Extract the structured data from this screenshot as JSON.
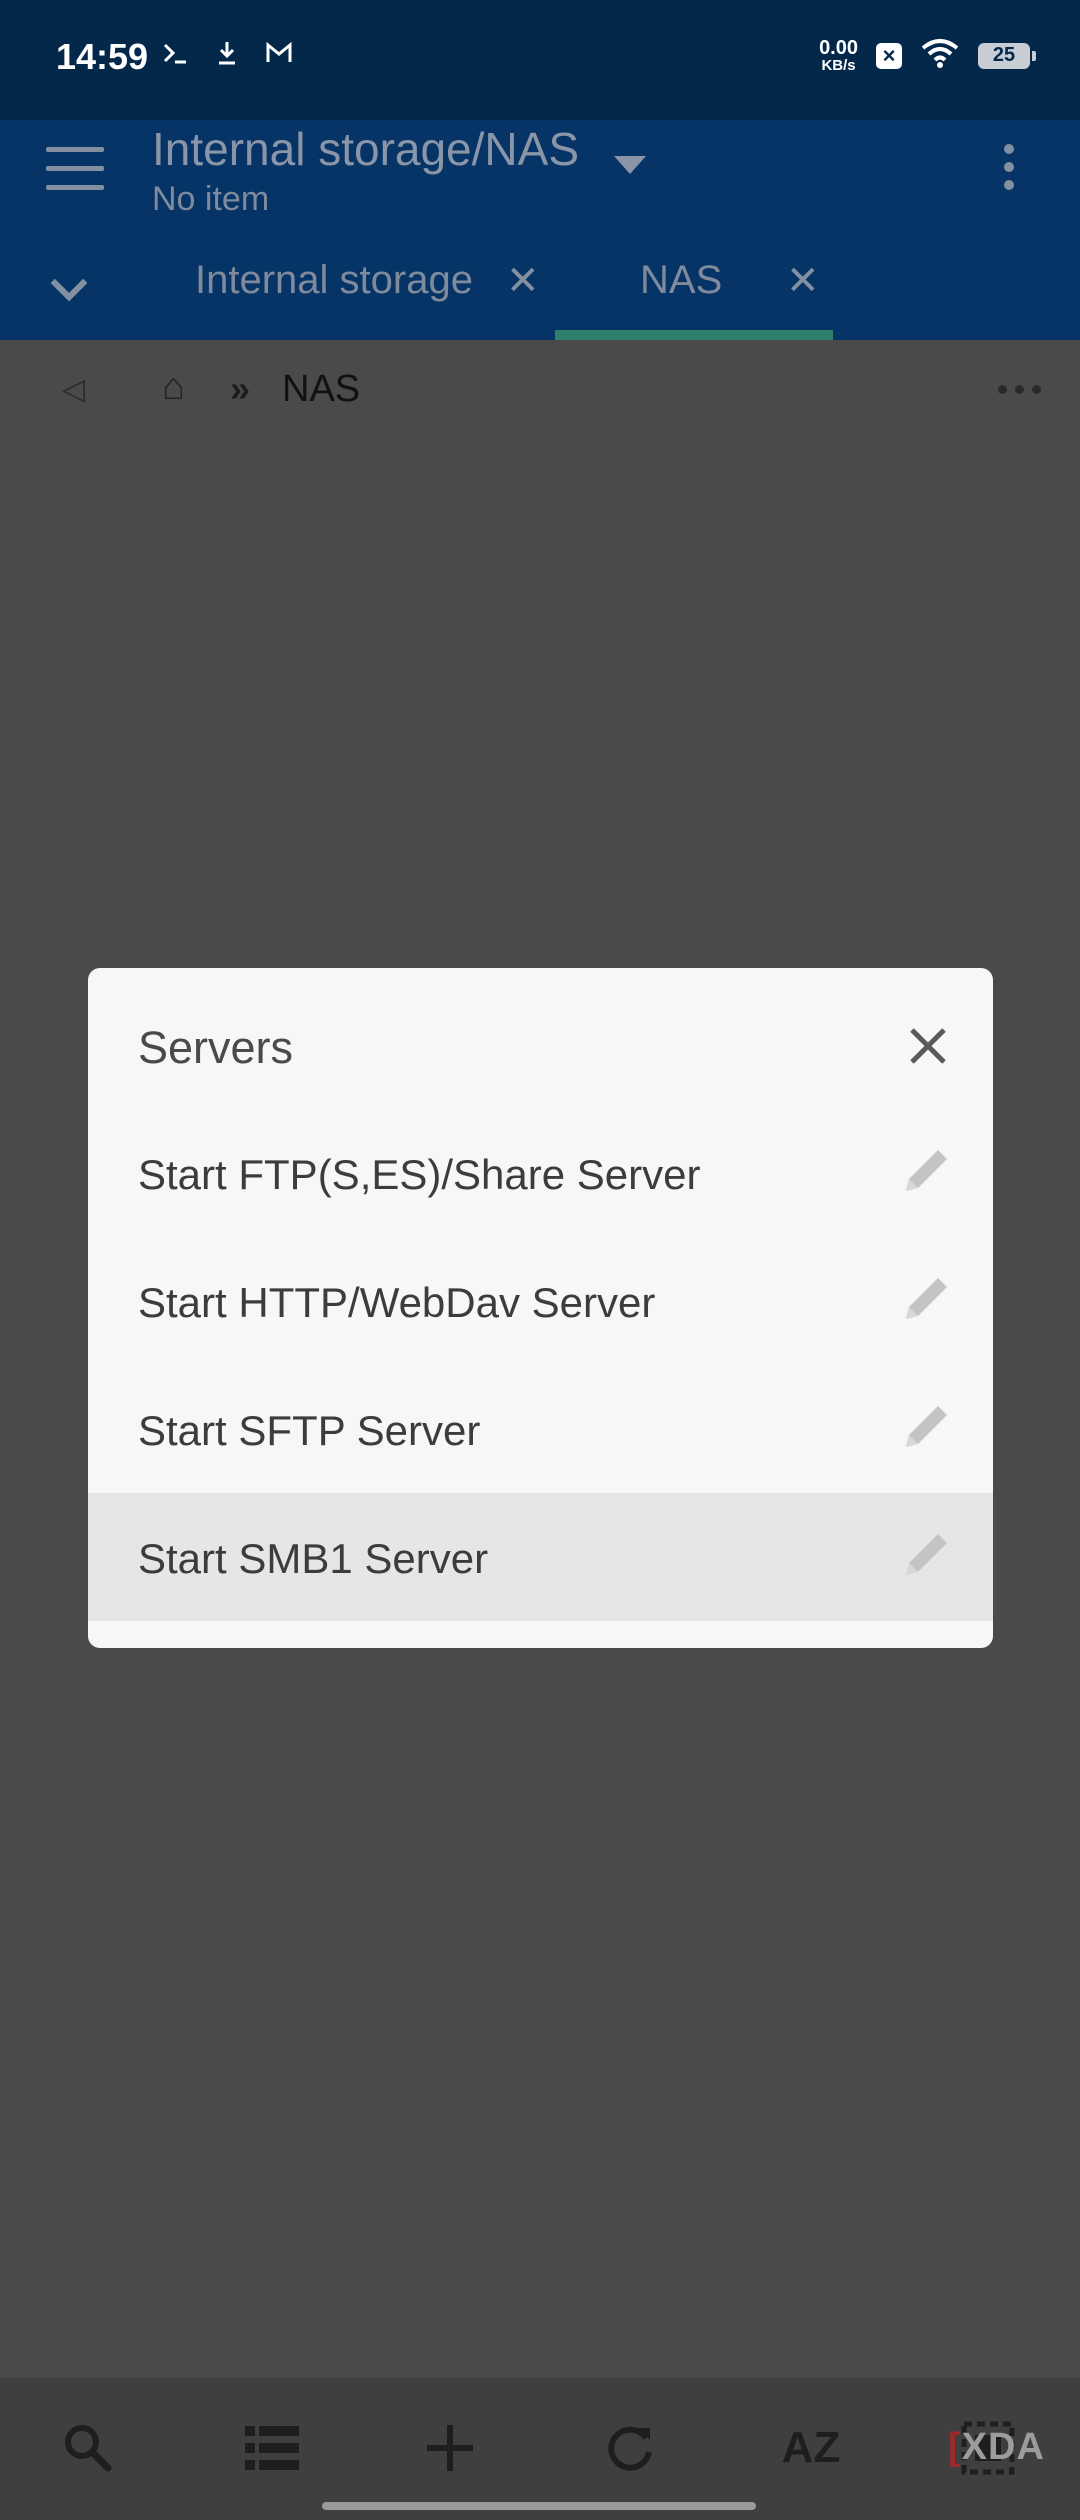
{
  "status_bar": {
    "time": "14:59",
    "left_icons": [
      "terminal-icon",
      "download-icon",
      "gmail-icon"
    ],
    "net_speed_value": "0.00",
    "net_speed_unit": "KB/s",
    "battery_level": "25"
  },
  "app_bar": {
    "title": "Internal storage/NAS",
    "subtitle": "No item"
  },
  "tabs": [
    {
      "label": "Internal storage",
      "active": false
    },
    {
      "label": "NAS",
      "active": true
    }
  ],
  "breadcrumb": {
    "separator": "»",
    "current": "NAS"
  },
  "dialog": {
    "title": "Servers",
    "items": [
      {
        "label": "Start FTP(S,ES)/Share Server",
        "selected": false
      },
      {
        "label": "Start HTTP/WebDav Server",
        "selected": false
      },
      {
        "label": "Start SFTP Server",
        "selected": false
      },
      {
        "label": "Start SMB1 Server",
        "selected": true
      }
    ]
  },
  "bottom_toolbar": {
    "sort_label": "AZ",
    "icons": [
      "search-icon",
      "list-view-icon",
      "add-icon",
      "refresh-icon",
      "sort-icon",
      "select-icon"
    ]
  },
  "watermark": "XDA",
  "colors": {
    "status_bar": "#03284a",
    "app_bar": "#063466",
    "scrim_background": "#4a4a4a",
    "dialog_background": "#f7f7f7",
    "selected_row": "#e6e6e6",
    "tab_indicator": "#2f7f6d"
  }
}
